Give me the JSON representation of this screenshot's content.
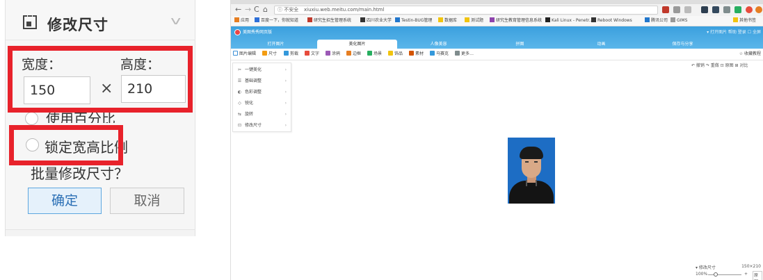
{
  "resize_panel": {
    "title": "修改尺寸",
    "width_label": "宽度：",
    "height_label": "高度：",
    "width_value": "150",
    "height_value": "210",
    "times_sign": "×",
    "use_percent_label": "使用百分比",
    "lock_ratio_label": "锁定宽高比例",
    "batch_label": "批量修改尺寸？",
    "ok_label": "确定",
    "cancel_label": "取消",
    "highlight_color": "#e8222b"
  },
  "browser": {
    "nav": {
      "back": "←",
      "forward": "→",
      "reload": "C",
      "home": "⌂"
    },
    "url_secure": "ⓘ 不安全",
    "url": "xiuxiu.web.meitu.com/main.html",
    "bookmarks": [
      "应用",
      "百度一下，你就知道",
      "研究生招生管理系统",
      "四川农业大学",
      "Testin-BUG管理",
      "数据库",
      "测试题",
      "研究生教育管理信息系统",
      "Kali Linux - Penetr...",
      "Reboot Windows",
      "腾讯公司",
      "GIMS",
      "其他书签"
    ]
  },
  "app": {
    "name": "美图秀秀网页版",
    "header_actions": "▾ 打开图片   帮助   登录   ☐ 全屏",
    "tabs": [
      "打开图片",
      "美化图片",
      "人像美容",
      "拼图",
      "动画",
      "保存与分享"
    ],
    "active_tab": 1,
    "toolbar": [
      "尺寸",
      "剪裁",
      "文字",
      "涂鸦",
      "边框",
      "场景",
      "饰品",
      "素材",
      "马赛克",
      "更多…"
    ],
    "toolbar_first": "图片编辑",
    "toolbar_right": "☆ 收藏教程",
    "side_menu": [
      {
        "icon": "✂",
        "label": "一键美化"
      },
      {
        "icon": "☰",
        "label": "基础调整"
      },
      {
        "icon": "◐",
        "label": "色彩调整"
      },
      {
        "icon": "◇",
        "label": "锐化"
      },
      {
        "icon": "⇆",
        "label": "旋转"
      },
      {
        "icon": "⊡",
        "label": "修改尺寸"
      }
    ],
    "right_tools": "↶ 撤销   ↷ 重做   ⊡ 原图   ⊞ 对比",
    "status_title": "▾ 修改尺寸",
    "status_size": "150×210",
    "zoom_label": "100%",
    "zoom_plus": "+",
    "zoom_orig": "原图"
  }
}
